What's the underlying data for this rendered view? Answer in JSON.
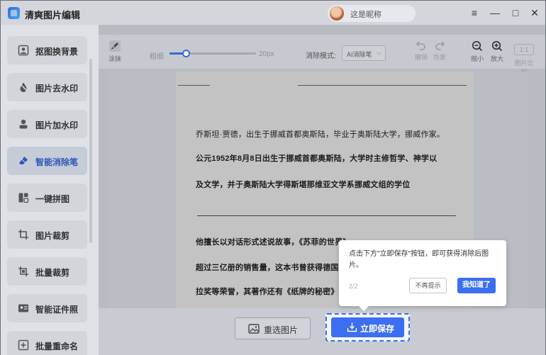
{
  "app": {
    "title": "清爽图片编辑",
    "username": "这是昵称"
  },
  "window_controls": {
    "menu": "≡",
    "minimize": "—",
    "maximize": "□",
    "close": "✕"
  },
  "sidebar": {
    "items": [
      {
        "label": "抠图换背景",
        "icon": "portrait-icon"
      },
      {
        "label": "图片去水印",
        "icon": "drop-icon"
      },
      {
        "label": "图片加水印",
        "icon": "person-icon"
      },
      {
        "label": "智能消除笔",
        "icon": "eraser-icon",
        "active": true
      },
      {
        "label": "一键拼图",
        "icon": "collage-icon"
      },
      {
        "label": "图片裁剪",
        "icon": "crop-icon"
      },
      {
        "label": "批量裁剪",
        "icon": "batch-crop-icon"
      },
      {
        "label": "智能证件照",
        "icon": "id-card-icon"
      },
      {
        "label": "批量重命名",
        "icon": "rename-icon"
      }
    ]
  },
  "toolbar": {
    "brush_label": "涂抹",
    "size_label": "粗细",
    "size_max": "20px",
    "size_value_fraction": 0.2,
    "mode_label": "消除模式:",
    "mode_value": "AI消除笔",
    "undo_label": "撤销",
    "redo_label": "恢复",
    "zoom_out_label": "缩小",
    "zoom_in_label": "放大",
    "ratio_label": "1:1",
    "original_label": "图片比例"
  },
  "document": {
    "lines": [
      "乔斯坦·贾德，出生于挪威首都奥斯陆，毕业于奥斯陆大学，挪威作家。",
      "公元1952年8月8日出生于挪威首都奥斯陆，大学时主修哲学、神学以",
      "及文学，并于奥斯陆大学得斯堪那维亚文学系挪威文组的学位",
      "他擅长以对话形式述说故事，《苏菲的世界》",
      "超过三亿册的销售量，这本书曾获得德国",
      "拉奖等荣誉，其著作还有《纸牌的秘密》"
    ]
  },
  "bottom": {
    "reselect_label": "重选图片",
    "save_label": "立即保存"
  },
  "tooltip": {
    "text": "点击下方\"立即保存\"按钮，即可获得消除后图片。",
    "step": "2/2",
    "skip_label": "不再提示",
    "ok_label": "我知道了"
  },
  "colors": {
    "accent": "#3b6ef0",
    "active_text": "#2e57b6"
  }
}
